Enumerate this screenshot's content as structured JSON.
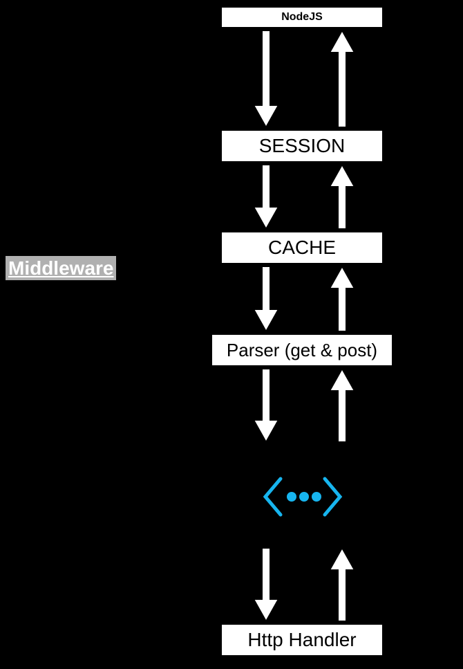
{
  "top_band": "NodeJS",
  "boxes": {
    "session": "SESSION",
    "cache": "CACHE",
    "parser": "Parser (get & post)",
    "http": "Http Handler"
  },
  "side_label": "Middleware",
  "accent_color": "#17b5ef"
}
